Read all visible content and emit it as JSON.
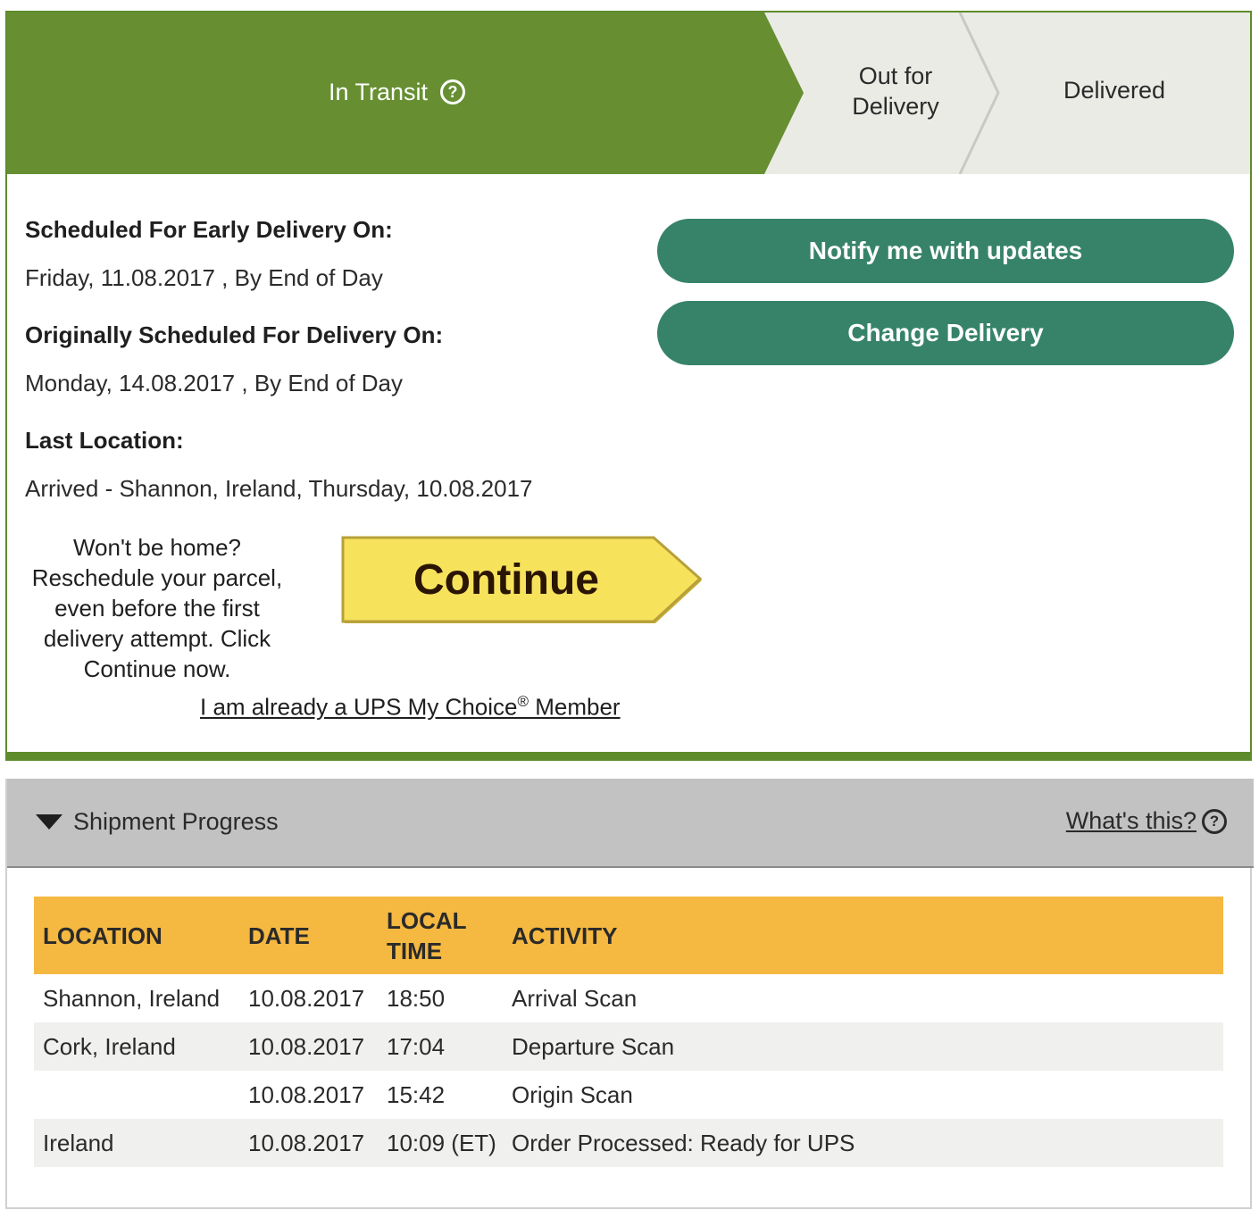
{
  "status_steps": {
    "current": "In Transit",
    "next": "Out for Delivery",
    "last": "Delivered"
  },
  "details": {
    "early_label": "Scheduled For Early Delivery On:",
    "early_value": "Friday, 11.08.2017 , By End of Day",
    "original_label": "Originally Scheduled For Delivery On:",
    "original_value": "Monday, 14.08.2017 , By End of Day",
    "last_location_label": "Last Location:",
    "last_location_value": "Arrived - Shannon, Ireland, Thursday, 10.08.2017"
  },
  "actions": {
    "notify_label": "Notify me with updates",
    "change_label": "Change Delivery"
  },
  "promo": {
    "text": "Won't be home? Reschedule your parcel, even before the first delivery attempt. Click Continue now.",
    "continue_label": "Continue",
    "member_link_pre": "I am already a UPS My Choice",
    "member_link_sup": "®",
    "member_link_post": " Member"
  },
  "shipment_progress": {
    "title": "Shipment Progress",
    "whats_this": "What's this?",
    "columns": [
      "LOCATION",
      "DATE",
      "LOCAL TIME",
      "ACTIVITY"
    ],
    "rows": [
      {
        "location": "Shannon,  Ireland",
        "date": "10.08.2017",
        "time": "18:50",
        "activity": "Arrival Scan"
      },
      {
        "location": "Cork,  Ireland",
        "date": "10.08.2017",
        "time": "17:04",
        "activity": "Departure Scan"
      },
      {
        "location": "",
        "date": "10.08.2017",
        "time": "15:42",
        "activity": "Origin Scan"
      },
      {
        "location": "Ireland",
        "date": "10.08.2017",
        "time": "10:09 (ET)",
        "activity": "Order Processed: Ready for UPS"
      }
    ]
  },
  "colors": {
    "brand_green": "#678f32",
    "button_teal": "#37836a",
    "continue_yellow": "#f7e25c",
    "table_header_amber": "#f5b841"
  }
}
